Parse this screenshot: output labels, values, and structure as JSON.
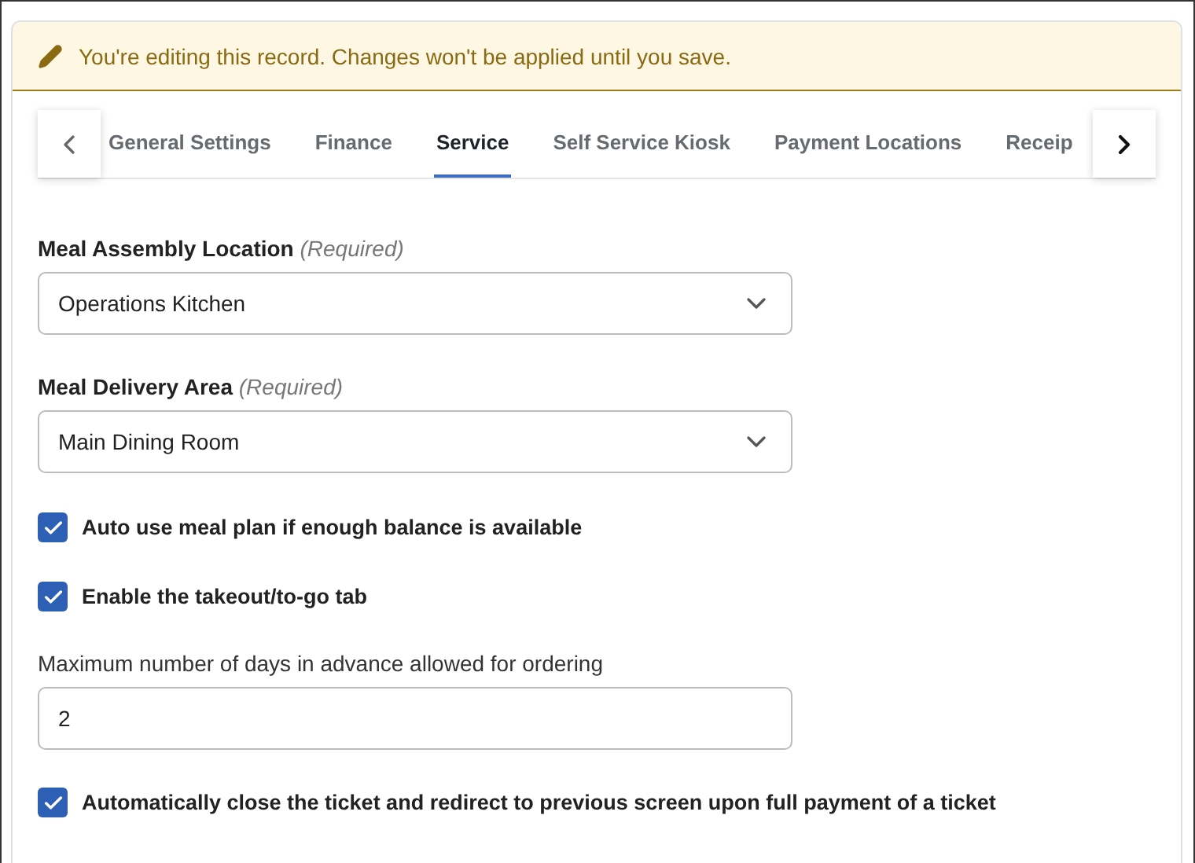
{
  "banner": {
    "text": "You're editing this record. Changes won't be applied until you save."
  },
  "tabs": [
    {
      "label": "General Settings",
      "selected": false
    },
    {
      "label": "Finance",
      "selected": false
    },
    {
      "label": "Service",
      "selected": true
    },
    {
      "label": "Self Service Kiosk",
      "selected": false
    },
    {
      "label": "Payment Locations",
      "selected": false
    },
    {
      "label": "Receip",
      "selected": false
    }
  ],
  "form": [
    {
      "kind": "select",
      "label": "Meal Assembly Location *(Required)*",
      "value": "Operations Kitchen"
    },
    {
      "kind": "select",
      "label": "Meal Delivery Area *(Required)*",
      "value": "Main Dining Room"
    },
    {
      "kind": "checkbox",
      "label": "Auto use meal plan if enough balance is available",
      "checked": true
    },
    {
      "kind": "checkbox",
      "label": "Enable the takeout/to-go tab",
      "checked": true
    },
    {
      "kind": "input",
      "label": "Maximum number of days in advance allowed for ordering",
      "value": "2"
    },
    {
      "kind": "checkbox",
      "label": "Automatically close the ticket and redirect to previous screen upon full payment of a ticket",
      "checked": true
    }
  ]
}
